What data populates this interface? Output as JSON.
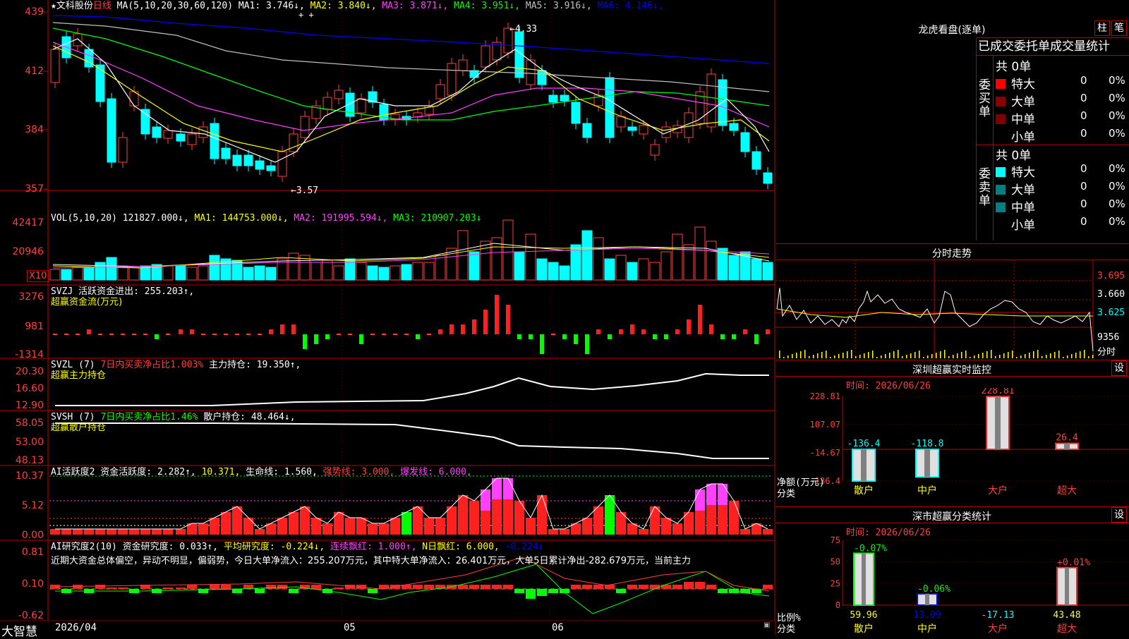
{
  "stock": {
    "name": "★文科股份",
    "period": "日线"
  },
  "main": {
    "ma_header": "MA(5,10,20,30,60,120)",
    "ma": [
      {
        "label": "MA1:",
        "value": "3.746↓",
        "color": "#ffffff"
      },
      {
        "label": "MA2:",
        "value": "3.840↓",
        "color": "#ffff00"
      },
      {
        "label": "MA3:",
        "value": "3.871↓",
        "color": "#ff40ff"
      },
      {
        "label": "MA4:",
        "value": "3.951↓",
        "color": "#00ff00"
      },
      {
        "label": "MA5:",
        "value": "3.916↓",
        "color": "#c0c0c0"
      },
      {
        "label": "MA6:",
        "value": "4.146↓",
        "color": "#0000ff"
      }
    ],
    "y_labels": [
      "439",
      "412",
      "384",
      "357"
    ],
    "high_mark": "←4.33",
    "low_mark": "←3.57",
    "plus_marks": "+ +"
  },
  "vol": {
    "header": "VOL(5,10,20)",
    "value": "121827.000↓,",
    "ma1": "MA1: 144753.000↓,",
    "ma2": "MA2: 191995.594↓,",
    "ma3": "MA3: 210907.203↓",
    "y_labels": [
      "42417",
      "20946"
    ],
    "unit": "X10"
  },
  "svzj": {
    "header": "SVZJ  活跃资金进出: 255.203↑,",
    "sub": "超赢资金流(万元)",
    "y_labels": [
      "3276",
      "981",
      "-1314"
    ]
  },
  "svzl": {
    "header": "SVZL (7)",
    "buy": "7日内买卖净占比1.003%",
    "hold": "主力持仓: 19.350↑,",
    "sub": "超赢主力持仓",
    "y_labels": [
      "20.30",
      "16.60",
      "12.90"
    ]
  },
  "svsh": {
    "header": "SVSH (7)",
    "buy": "7日内买卖净占比1.46%",
    "hold": "散户持仓: 48.464↓,",
    "sub": "超赢散户持仓",
    "y_labels": [
      "58.05",
      "53.00",
      "48.13"
    ]
  },
  "ai1": {
    "header": "AI活跃度2 资金活跃度: 2.282↑,",
    "v2": "10.371,",
    "life": "生命线: 1.560,",
    "strong": "强势线: 3.000,",
    "burst": "爆发线: 6.000,",
    "y_labels": [
      "10.37",
      "5.12",
      "0.00"
    ]
  },
  "ai2": {
    "header": "AI研究度2(10) 资金研究度: 0.033↑,",
    "avg": "平均研究度: -0.224↓,",
    "red": "连续飘红: 1.000↑,",
    "nred": "N日飘红: 6.000,",
    "last": "-0.224↓",
    "desc": "近期大资金总体偏空，异动不明显，偏弱势，今日大单净流入：255.207万元，其中特大单净流入：26.401万元，大单5日累计净出-282.679万元，当前主力",
    "y_labels": [
      "0.81",
      "0.10",
      "-0.62"
    ]
  },
  "date_axis": {
    "start": "2026/04",
    "m05": "05",
    "m06": "06"
  },
  "brand": "大智慧",
  "lhb": {
    "title": "龙虎看盘(逐单)",
    "btn1": "柱",
    "btn2": "笔",
    "tabs": "已成交委托单成交量统计",
    "buy_label": "委买单",
    "sell_label": "委卖单",
    "buy_total": "共 0单",
    "sell_total": "共 0单",
    "rows": [
      "特大",
      "大单",
      "中单",
      "小单"
    ],
    "zero": "0",
    "pct": "0%"
  },
  "fenshi": {
    "title": "分时走势",
    "y_labels": [
      "3.695",
      "3.660",
      "3.625",
      "9356"
    ],
    "unit": "分时"
  },
  "sz_monitor": {
    "title": "深圳超赢实时监控",
    "btn": "设",
    "time": "时间: 2026/06/26",
    "y_labels": [
      "228.81",
      "107.07",
      "-14.67",
      "-136.4"
    ],
    "yunit": "净额(万元)",
    "cat_label": "分类",
    "categories": [
      "散户",
      "中户",
      "大户",
      "超大"
    ],
    "values": [
      "-136.4",
      "-118.8",
      "228.81",
      "26.4"
    ]
  },
  "sz_class": {
    "title": "深市超赢分类统计",
    "btn": "设",
    "time": "时间: 2026/06/26",
    "y_labels": [
      "75",
      "50",
      "25",
      "0"
    ],
    "yunit": "比例%",
    "cat_label": "分类",
    "categories": [
      "散户",
      "中户",
      "大户",
      "超大"
    ],
    "top": [
      "-0.07%",
      "-0.06%",
      "",
      "+0.01%"
    ],
    "bottom": [
      "59.96",
      "13.09",
      "-17.13",
      "43.48"
    ]
  },
  "chart_data": [
    {
      "type": "bar",
      "title": "深圳超赢实时监控",
      "ylabel": "净额(万元)",
      "categories": [
        "散户",
        "中户",
        "大户",
        "超大"
      ],
      "values": [
        -136.4,
        -118.8,
        228.81,
        26.4
      ],
      "ylim": [
        -136.4,
        228.81
      ]
    },
    {
      "type": "bar",
      "title": "深市超赢分类统计",
      "ylabel": "比例%",
      "categories": [
        "散户",
        "中户",
        "大户",
        "超大"
      ],
      "values": [
        59.96,
        13.09,
        0,
        43.48
      ],
      "ylim": [
        0,
        75
      ]
    }
  ]
}
